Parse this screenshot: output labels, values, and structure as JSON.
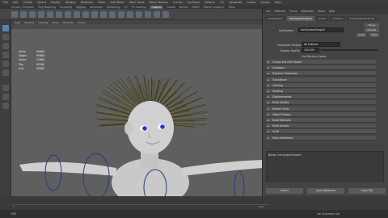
{
  "app": {
    "menubar": [
      "File",
      "Edit",
      "Create",
      "Select",
      "Modify",
      "Display",
      "Windows",
      "Mesh",
      "Edit Mesh",
      "Mesh Tools",
      "Mesh Display",
      "Curves",
      "Surfaces",
      "Deform",
      "UV",
      "Generate",
      "Cache",
      "Arnold",
      "Help"
    ],
    "workspace_label": "No Live Surface"
  },
  "shelf_tabs": [
    {
      "label": "Curves / Surfaces"
    },
    {
      "label": "Poly Modeling"
    },
    {
      "label": "Sculpting"
    },
    {
      "label": "Rigging"
    },
    {
      "label": "Animation"
    },
    {
      "label": "Rendering"
    },
    {
      "label": "FX"
    },
    {
      "label": "FX Caching"
    },
    {
      "label": "Custom"
    },
    {
      "label": "Arnold"
    },
    {
      "label": "Bifrost"
    },
    {
      "label": "MASH"
    },
    {
      "label": "Motion Graphics"
    },
    {
      "label": "XGen"
    }
  ],
  "viewport": {
    "menu": [
      "View",
      "Shading",
      "Lighting",
      "Show",
      "Renderer",
      "Panels"
    ],
    "stats": [
      {
        "label": "Verts:",
        "value": "95660"
      },
      {
        "label": "Edges:",
        "value": "95685"
      },
      {
        "label": "Faces:",
        "value": "47680"
      },
      {
        "label": "Tris:",
        "value": "95360"
      },
      {
        "label": "UVs:",
        "value": "95680"
      }
    ]
  },
  "attribute_editor": {
    "menu": [
      "List",
      "Selected",
      "Focus",
      "Attributes",
      "Show",
      "Help"
    ],
    "tabs": [
      "hairSystem1",
      "hairSystemShape1",
      "time1",
      "nucleus1",
      "hairSystem1Follicles"
    ],
    "active_tab": 1,
    "node_label": "hairSystem:",
    "node_value": "hairSystemShape1",
    "buttons": {
      "focus": "Focus",
      "presets": "Presets",
      "show": "Show",
      "hide": "Hide"
    },
    "simulation_method_label": "Simulation Method",
    "simulation_method_value": "All Follicles",
    "display_quality_label": "Display Quality",
    "display_quality_value": "100.000",
    "checkbox_label": "Use Nucleus Solver",
    "sections": [
      "Clump and Hair Shape",
      "Collisions",
      "Dynamic Properties",
      "Turbulence",
      "Caching",
      "Shading",
      "Displacements",
      "Multi Streaks",
      "Render Stats",
      "Object Display",
      "Node Behavior",
      "Multi Streaks",
      "UUID",
      "Extra Attributes"
    ],
    "notes_label": "Notes: hairSystemShape1",
    "bottom_buttons": [
      "Select",
      "Load Attributes",
      "Copy Tab"
    ]
  },
  "timeline": {
    "start": "1",
    "end": "120",
    "playback_label": "No Character Set",
    "anim_layer": "No Anim Layer"
  },
  "cmdline": {
    "label": "MEL",
    "status": "No Character Set"
  }
}
